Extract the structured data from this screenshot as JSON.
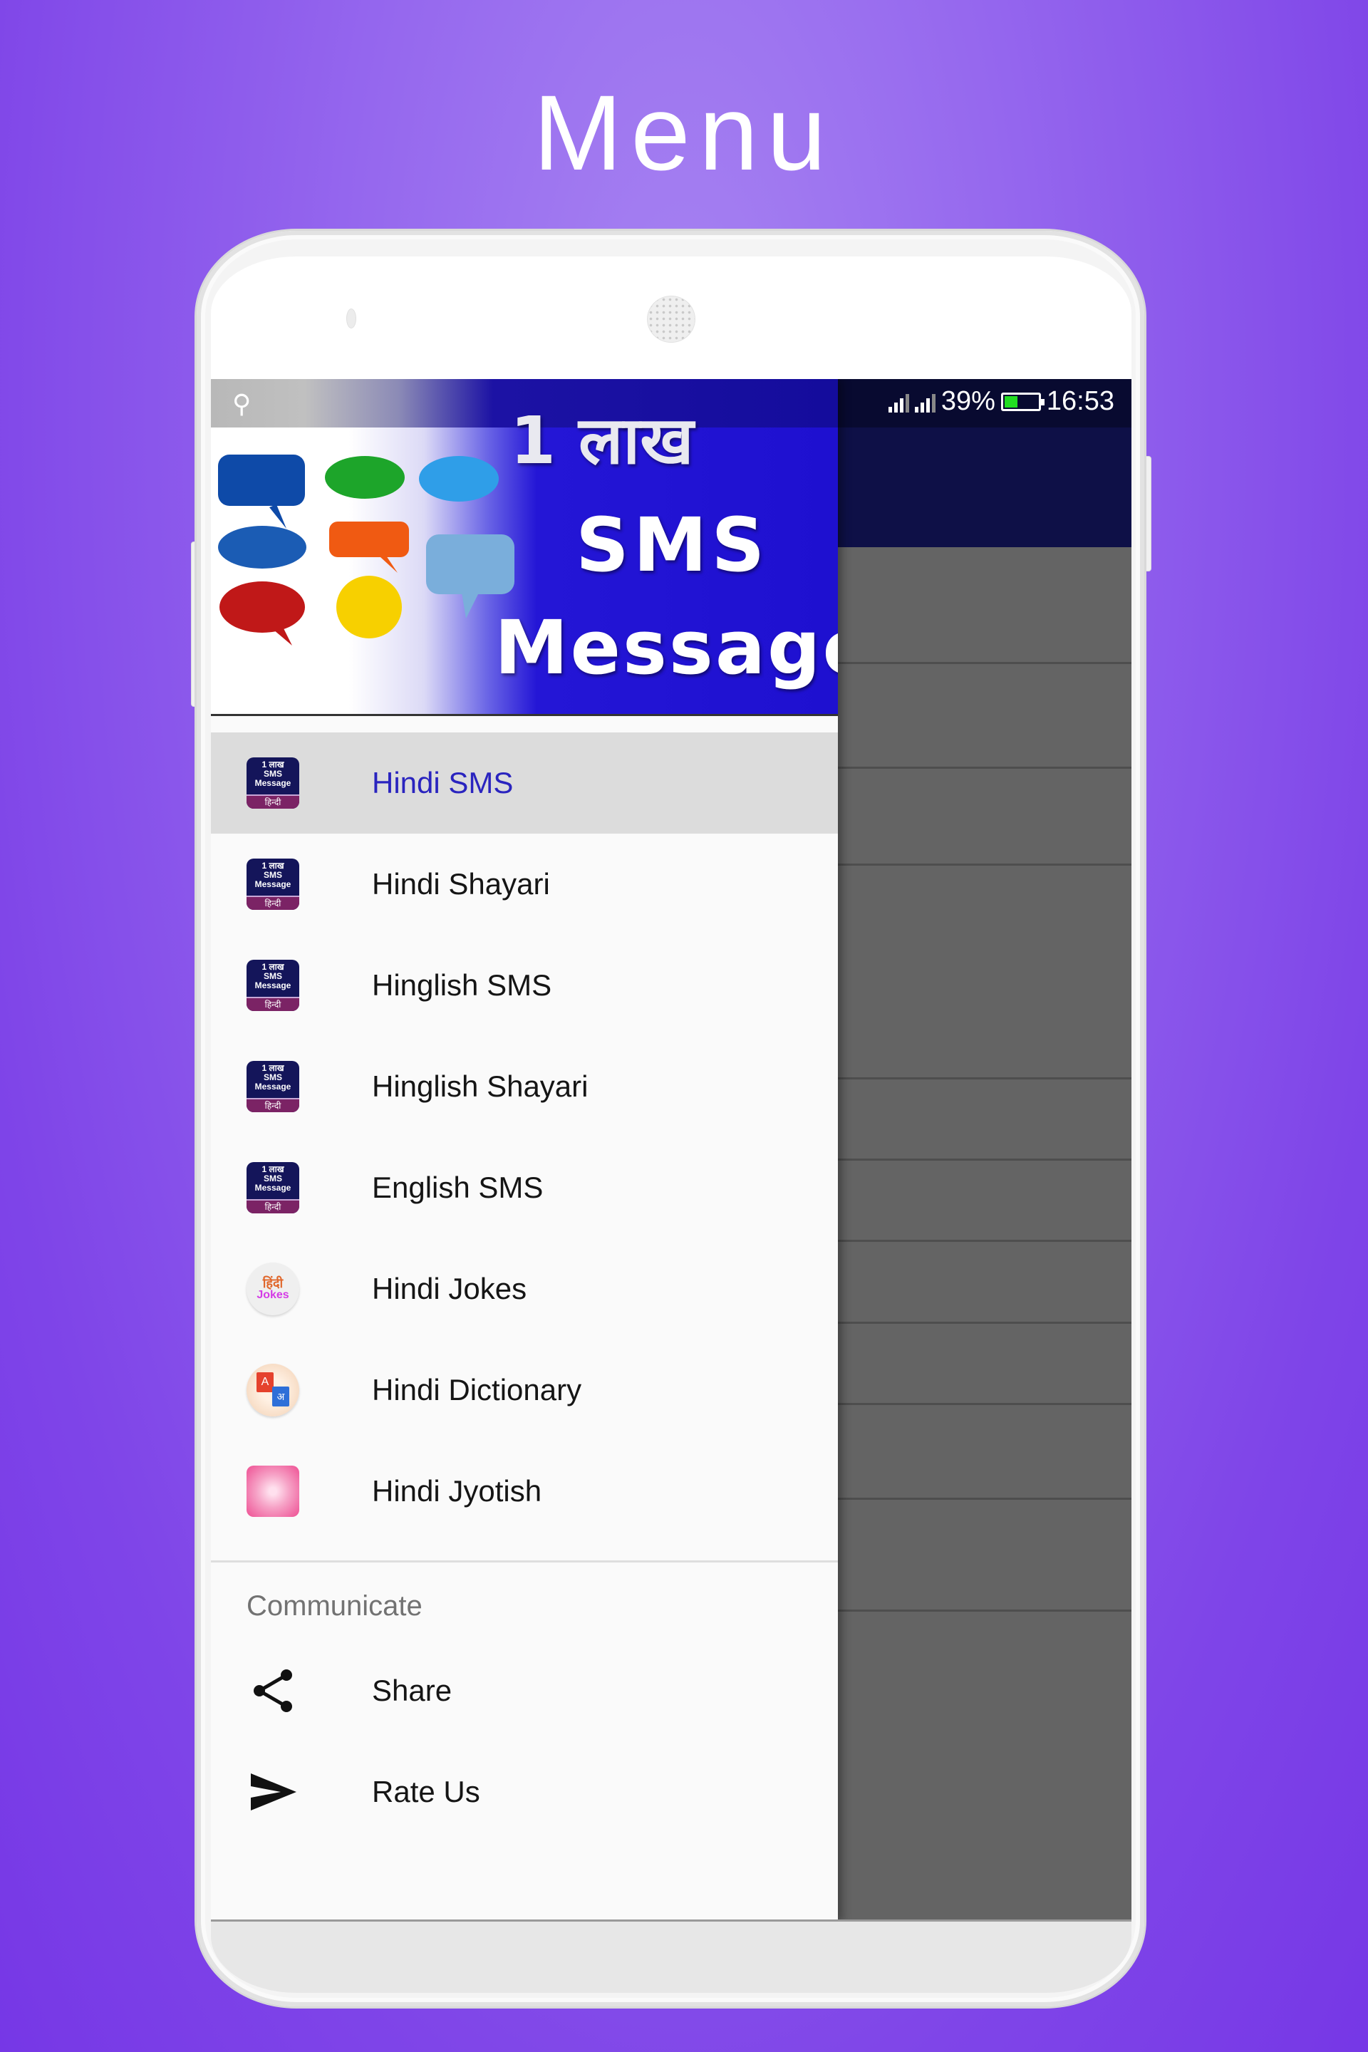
{
  "promo": {
    "title": "Menu"
  },
  "status_bar": {
    "usb_icon": "usb-icon",
    "signal_icons": [
      "signal-sim1-icon",
      "signal-sim2-icon"
    ],
    "battery_percent_text": "39%",
    "battery_level": 0.39,
    "time": "16:53"
  },
  "drawer_header": {
    "line1": "1 लाख",
    "line2": "SMS",
    "line3": "Message",
    "image": "speech-bubbles-illustration"
  },
  "menu": {
    "items": [
      {
        "label": "Hindi SMS",
        "icon": "app-1lakh-sms-icon",
        "active": true
      },
      {
        "label": "Hindi Shayari",
        "icon": "app-1lakh-sms-icon",
        "active": false
      },
      {
        "label": "Hinglish SMS",
        "icon": "app-1lakh-sms-icon",
        "active": false
      },
      {
        "label": "Hinglish Shayari",
        "icon": "app-1lakh-sms-icon",
        "active": false
      },
      {
        "label": "English SMS",
        "icon": "app-1lakh-sms-icon",
        "active": false
      },
      {
        "label": "Hindi Jokes",
        "icon": "hindi-jokes-app-icon",
        "active": false
      },
      {
        "label": "Hindi Dictionary",
        "icon": "hindi-dictionary-app-icon",
        "active": false
      },
      {
        "label": "Hindi Jyotish",
        "icon": "hindi-jyotish-app-icon",
        "active": false
      }
    ],
    "app_icon_text": {
      "l1": "1 लाख",
      "l2": "SMS",
      "l3": "Message",
      "l4": "हिन्दी"
    },
    "jokes_icon_text": {
      "l1": "हिंदी",
      "l2": "Jokes"
    },
    "dict_icon_text": {
      "l1": "A",
      "l2": "अ"
    }
  },
  "communicate": {
    "title": "Communicate",
    "items": [
      {
        "label": "Share",
        "icon": "share-icon"
      },
      {
        "label": "Rate Us",
        "icon": "send-icon"
      }
    ]
  },
  "colors": {
    "background": "#8a55ec",
    "app_bar": "#0e1047",
    "active_text": "#2a24bf",
    "active_bg": "#dcdcdc",
    "scrim": "#646464",
    "battery_fill": "#22dd22"
  }
}
